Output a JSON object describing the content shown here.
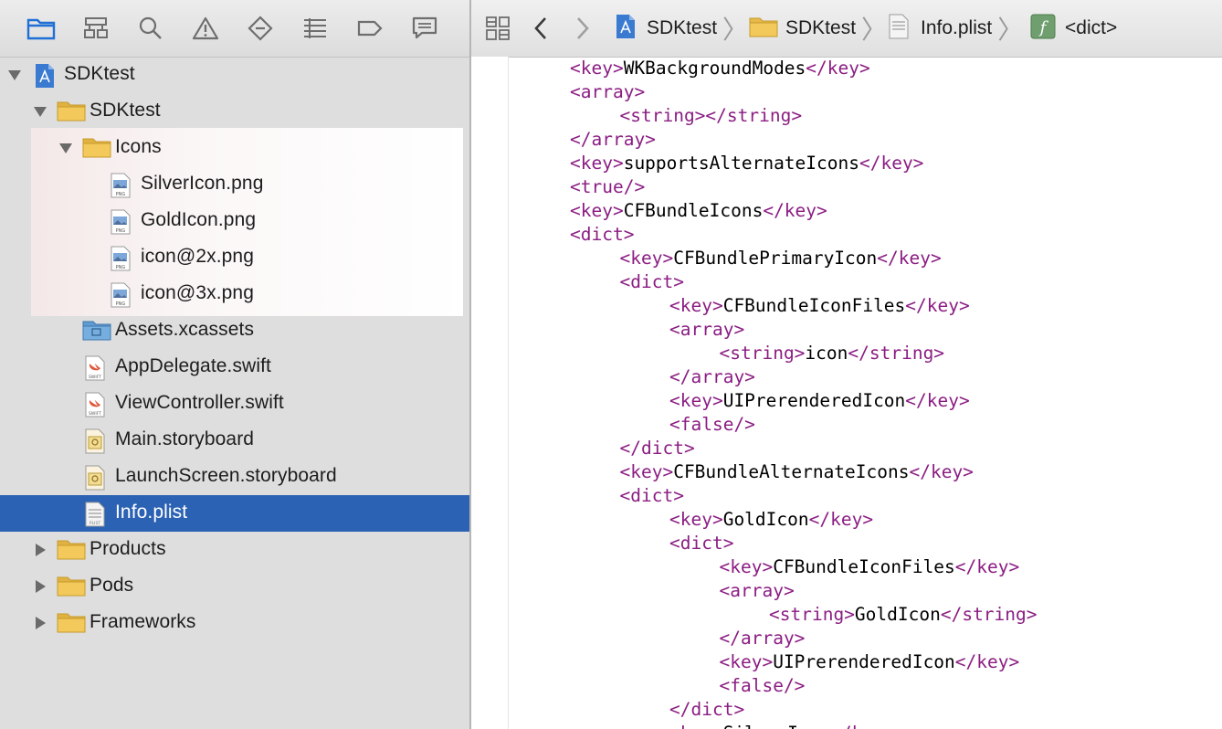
{
  "navigator": {
    "toolbar_icons": [
      "folder-icon",
      "hierarchy-icon",
      "search-icon",
      "warning-icon",
      "test-diamond-icon",
      "list-icon",
      "breakpoint-icon",
      "report-icon"
    ],
    "items": [
      {
        "label": "SDKtest",
        "kind": "project",
        "expanded": true
      },
      {
        "label": "SDKtest",
        "kind": "folder",
        "expanded": true
      },
      {
        "label": "Icons",
        "kind": "folder",
        "expanded": true
      },
      {
        "label": "SilverIcon.png",
        "kind": "png"
      },
      {
        "label": "GoldIcon.png",
        "kind": "png"
      },
      {
        "label": "icon@2x.png",
        "kind": "png"
      },
      {
        "label": "icon@3x.png",
        "kind": "png"
      },
      {
        "label": "Assets.xcassets",
        "kind": "assets"
      },
      {
        "label": "AppDelegate.swift",
        "kind": "swift"
      },
      {
        "label": "ViewController.swift",
        "kind": "swift"
      },
      {
        "label": "Main.storyboard",
        "kind": "storyboard"
      },
      {
        "label": "LaunchScreen.storyboard",
        "kind": "storyboard"
      },
      {
        "label": "Info.plist",
        "kind": "plist",
        "selected": true
      },
      {
        "label": "Products",
        "kind": "folder",
        "expanded": false
      },
      {
        "label": "Pods",
        "kind": "folder",
        "expanded": false
      },
      {
        "label": "Frameworks",
        "kind": "folder",
        "expanded": false
      }
    ]
  },
  "jumpbar": {
    "crumbs": [
      "SDKtest",
      "SDKtest",
      "Info.plist",
      "<dict>"
    ],
    "icons": [
      "related-items-icon",
      "back-arrow-icon",
      "forward-arrow-icon"
    ]
  },
  "editor": {
    "lines": [
      [
        {
          "c": "t",
          "s": "<key>"
        },
        {
          "c": "v",
          "s": "WKBackgroundModes"
        },
        {
          "c": "t",
          "s": "</key>"
        }
      ],
      [
        {
          "c": "t",
          "s": "<array>"
        }
      ],
      [
        {
          "c": "t",
          "s": "<string></string>"
        }
      ],
      [
        {
          "c": "t",
          "s": "</array>"
        }
      ],
      [
        {
          "c": "t",
          "s": "<key>"
        },
        {
          "c": "v",
          "s": "supportsAlternateIcons"
        },
        {
          "c": "t",
          "s": "</key>"
        }
      ],
      [
        {
          "c": "t",
          "s": "<true/>"
        }
      ],
      [
        {
          "c": "t",
          "s": "<key>"
        },
        {
          "c": "v",
          "s": "CFBundleIcons"
        },
        {
          "c": "t",
          "s": "</key>"
        }
      ],
      [
        {
          "c": "t",
          "s": "<dict>"
        }
      ],
      [
        {
          "c": "t",
          "s": "<key>"
        },
        {
          "c": "v",
          "s": "CFBundlePrimaryIcon"
        },
        {
          "c": "t",
          "s": "</key>"
        }
      ],
      [
        {
          "c": "t",
          "s": "<dict>"
        }
      ],
      [
        {
          "c": "t",
          "s": "<key>"
        },
        {
          "c": "v",
          "s": "CFBundleIconFiles"
        },
        {
          "c": "t",
          "s": "</key>"
        }
      ],
      [
        {
          "c": "t",
          "s": "<array>"
        }
      ],
      [
        {
          "c": "t",
          "s": "<string>"
        },
        {
          "c": "v",
          "s": "icon"
        },
        {
          "c": "t",
          "s": "</string>"
        }
      ],
      [
        {
          "c": "t",
          "s": "</array>"
        }
      ],
      [
        {
          "c": "t",
          "s": "<key>"
        },
        {
          "c": "v",
          "s": "UIPrerenderedIcon"
        },
        {
          "c": "t",
          "s": "</key>"
        }
      ],
      [
        {
          "c": "t",
          "s": "<false/>"
        }
      ],
      [
        {
          "c": "t",
          "s": "</dict>"
        }
      ],
      [
        {
          "c": "t",
          "s": "<key>"
        },
        {
          "c": "v",
          "s": "CFBundleAlternateIcons"
        },
        {
          "c": "t",
          "s": "</key>"
        }
      ],
      [
        {
          "c": "t",
          "s": "<dict>"
        }
      ],
      [
        {
          "c": "t",
          "s": "<key>"
        },
        {
          "c": "v",
          "s": "GoldIcon"
        },
        {
          "c": "t",
          "s": "</key>"
        }
      ],
      [
        {
          "c": "t",
          "s": "<dict>"
        }
      ],
      [
        {
          "c": "t",
          "s": "<key>"
        },
        {
          "c": "v",
          "s": "CFBundleIconFiles"
        },
        {
          "c": "t",
          "s": "</key>"
        }
      ],
      [
        {
          "c": "t",
          "s": "<array>"
        }
      ],
      [
        {
          "c": "t",
          "s": "<string>"
        },
        {
          "c": "v",
          "s": "GoldIcon"
        },
        {
          "c": "t",
          "s": "</string>"
        }
      ],
      [
        {
          "c": "t",
          "s": "</array>"
        }
      ],
      [
        {
          "c": "t",
          "s": "<key>"
        },
        {
          "c": "v",
          "s": "UIPrerenderedIcon"
        },
        {
          "c": "t",
          "s": "</key>"
        }
      ],
      [
        {
          "c": "t",
          "s": "<false/>"
        }
      ],
      [
        {
          "c": "t",
          "s": "</dict>"
        }
      ],
      [
        {
          "c": "t",
          "s": "<key>"
        },
        {
          "c": "v",
          "s": "SilverIcon"
        },
        {
          "c": "t",
          "s": "</key>"
        }
      ]
    ]
  },
  "colors": {
    "tag": "#8b1d83",
    "selection": "#2c62b3",
    "sidebar": "#dedede"
  }
}
